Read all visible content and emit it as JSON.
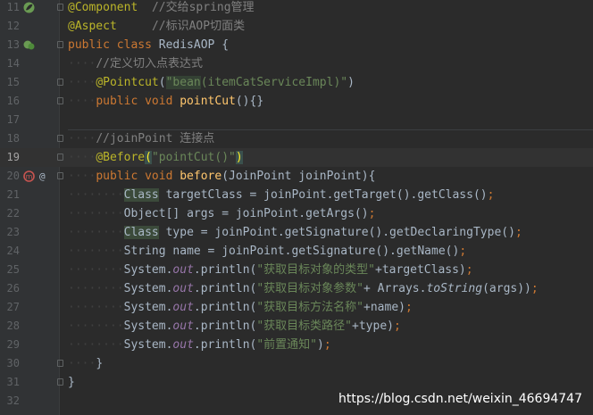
{
  "lines": [
    {
      "num": "11",
      "tokens": [
        [
          "ann",
          "@Component"
        ],
        [
          "",
          "  "
        ],
        [
          "cm",
          "//交给spring管理"
        ]
      ]
    },
    {
      "num": "12",
      "tokens": [
        [
          "ann",
          "@Aspect"
        ],
        [
          "",
          "     "
        ],
        [
          "cm",
          "//标识AOP切面类"
        ]
      ]
    },
    {
      "num": "13",
      "tokens": [
        [
          "kw",
          "public class "
        ],
        [
          "",
          "RedisAOP {"
        ]
      ]
    },
    {
      "num": "14",
      "tokens": [
        [
          "ws",
          "····"
        ],
        [
          "cm",
          "//定义切入点表达式"
        ]
      ]
    },
    {
      "num": "15",
      "tokens": [
        [
          "ws",
          "····"
        ],
        [
          "ann",
          "@Pointcut"
        ],
        [
          "",
          "("
        ],
        [
          "str hlk",
          "\"bean"
        ],
        [
          "str",
          "(itemCatServiceImpl)\""
        ],
        [
          "",
          ")"
        ]
      ]
    },
    {
      "num": "16",
      "tokens": [
        [
          "ws",
          "····"
        ],
        [
          "kw",
          "public void "
        ],
        [
          "fn",
          "pointCut"
        ],
        [
          "",
          "(){}"
        ]
      ]
    },
    {
      "num": "17",
      "tokens": []
    },
    {
      "num": "18",
      "tokens": [
        [
          "ws",
          "····"
        ],
        [
          "cm",
          "//joinPoint 连接点"
        ]
      ]
    },
    {
      "num": "19",
      "tokens": [
        [
          "ws",
          "····"
        ],
        [
          "ann",
          "@Before"
        ],
        [
          "brace",
          "("
        ],
        [
          "str",
          "\"pointCut()\""
        ],
        [
          "brace",
          ")"
        ]
      ]
    },
    {
      "num": "20",
      "tokens": [
        [
          "ws",
          "····"
        ],
        [
          "kw",
          "public void "
        ],
        [
          "fn",
          "before"
        ],
        [
          "",
          "(JoinPoint joinPoint){"
        ]
      ]
    },
    {
      "num": "21",
      "tokens": [
        [
          "ws",
          "········"
        ],
        [
          "hlc",
          "Class"
        ],
        [
          "",
          " targetClass = joinPoint.getTarget().getClass()"
        ],
        [
          "kw",
          ";"
        ]
      ]
    },
    {
      "num": "22",
      "tokens": [
        [
          "ws",
          "········"
        ],
        [
          "",
          "Object[] args = joinPoint.getArgs()"
        ],
        [
          "kw",
          ";"
        ]
      ]
    },
    {
      "num": "23",
      "tokens": [
        [
          "ws",
          "········"
        ],
        [
          "hlc",
          "Class"
        ],
        [
          "",
          " type = joinPoint.getSignature().getDeclaringType()"
        ],
        [
          "kw",
          ";"
        ]
      ]
    },
    {
      "num": "24",
      "tokens": [
        [
          "ws",
          "········"
        ],
        [
          "",
          "String name = joinPoint.getSignature().getName()"
        ],
        [
          "kw",
          ";"
        ]
      ]
    },
    {
      "num": "25",
      "tokens": [
        [
          "ws",
          "········"
        ],
        [
          "",
          "System."
        ],
        [
          "st",
          "out"
        ],
        [
          "",
          ".println("
        ],
        [
          "str",
          "\"获取目标对象的类型\""
        ],
        [
          "",
          "+targetClass)"
        ],
        [
          "kw",
          ";"
        ]
      ]
    },
    {
      "num": "26",
      "tokens": [
        [
          "ws",
          "········"
        ],
        [
          "",
          "System."
        ],
        [
          "st",
          "out"
        ],
        [
          "",
          ".println("
        ],
        [
          "str",
          "\"获取目标对象参数\""
        ],
        [
          "",
          "+ Arrays."
        ],
        [
          "it",
          "toString"
        ],
        [
          "",
          "(args))"
        ],
        [
          "kw",
          ";"
        ]
      ]
    },
    {
      "num": "27",
      "tokens": [
        [
          "ws",
          "········"
        ],
        [
          "",
          "System."
        ],
        [
          "st",
          "out"
        ],
        [
          "",
          ".println("
        ],
        [
          "str",
          "\"获取目标方法名称\""
        ],
        [
          "",
          "+name)"
        ],
        [
          "kw",
          ";"
        ]
      ]
    },
    {
      "num": "28",
      "tokens": [
        [
          "ws",
          "········"
        ],
        [
          "",
          "System."
        ],
        [
          "st",
          "out"
        ],
        [
          "",
          ".println("
        ],
        [
          "str",
          "\"获取目标类路径\""
        ],
        [
          "",
          "+type)"
        ],
        [
          "kw",
          ";"
        ]
      ]
    },
    {
      "num": "29",
      "tokens": [
        [
          "ws",
          "········"
        ],
        [
          "",
          "System."
        ],
        [
          "st",
          "out"
        ],
        [
          "",
          ".println("
        ],
        [
          "str",
          "\"前置通知\""
        ],
        [
          "",
          ")"
        ],
        [
          "kw",
          ";"
        ]
      ]
    },
    {
      "num": "30",
      "tokens": [
        [
          "ws",
          "····"
        ],
        [
          "",
          "}"
        ]
      ]
    },
    {
      "num": "31",
      "tokens": [
        [
          "",
          "}"
        ]
      ]
    },
    {
      "num": "32",
      "tokens": []
    }
  ],
  "current_line": "19",
  "gutter_icons": {
    "11": "spring-bean-icon",
    "13": "spring-aspect-icon",
    "20": "advice-method-icon"
  },
  "watermark": "https://blog.csdn.net/weixin_46694747"
}
